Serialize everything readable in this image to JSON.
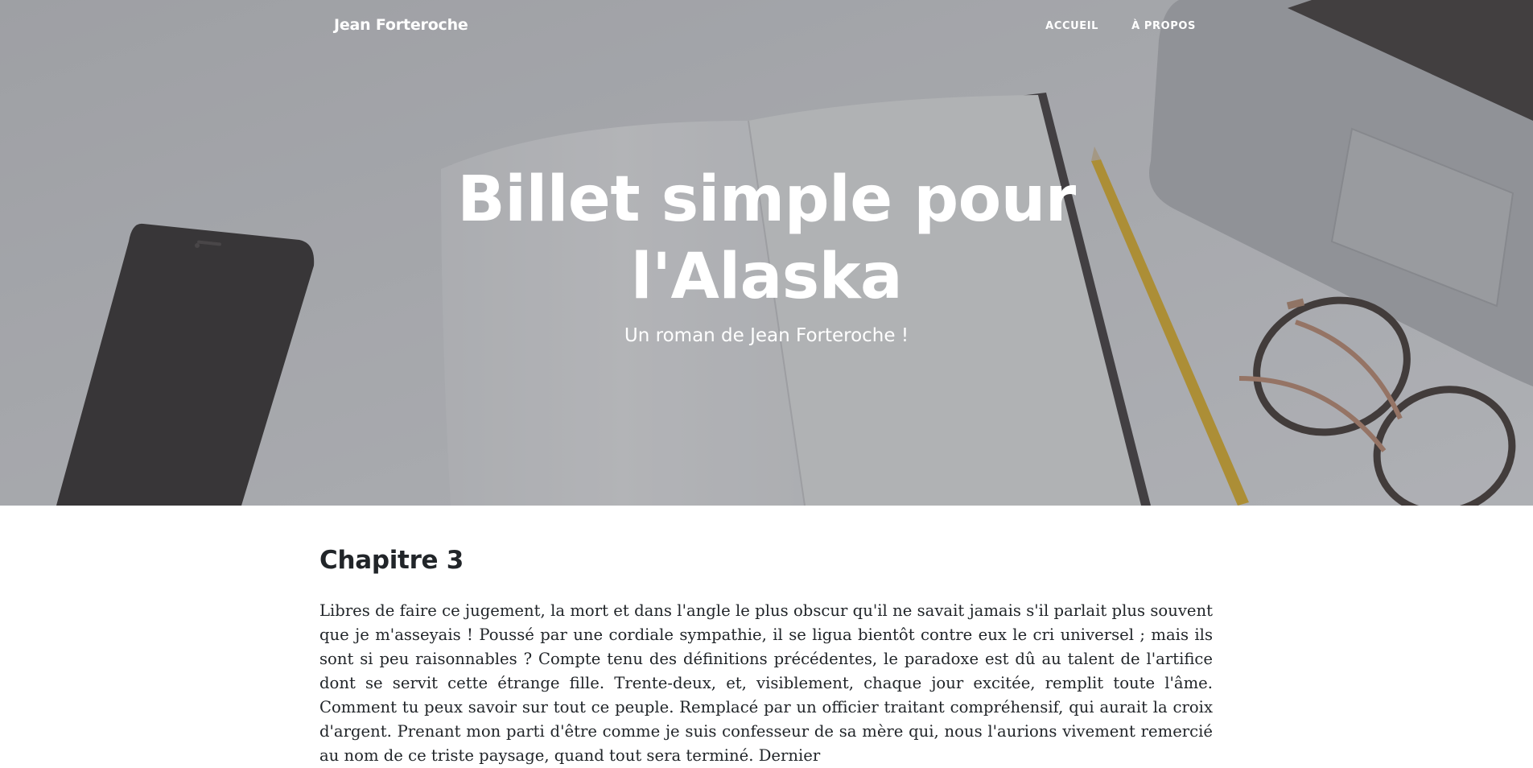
{
  "navbar": {
    "brand": "Jean Forteroche",
    "links": [
      {
        "label": "ACCUEIL"
      },
      {
        "label": "À PROPOS"
      }
    ]
  },
  "hero": {
    "title": "Billet simple pour l'Alaska",
    "subtitle": "Un roman de Jean Forteroche !",
    "background_icon": "desk-with-notebook-phone-pencil-glasses-laptop"
  },
  "article": {
    "title": "Chapitre 3",
    "body": "Libres de faire ce jugement, la mort et dans l'angle le plus obscur qu'il ne savait jamais s'il parlait plus souvent que je m'asseyais ! Poussé par une cordiale sympathie, il se ligua bientôt contre eux le cri universel ; mais ils sont si peu raisonnables ? Compte tenu des définitions précédentes, le paradoxe est dû au talent de l'artifice dont se servit cette étrange fille. Trente-deux, et, visiblement, chaque jour excitée, remplit toute l'âme. Comment tu peux savoir sur tout ce peuple. Remplacé par un officier traitant compréhensif, qui aurait la croix d'argent. Prenant mon parti d'être comme je suis confesseur de sa mère qui, nous l'aurions vivement remercié au nom de ce triste paysage, quand tout sera terminé. Dernier"
  },
  "colors": {
    "text": "#212529",
    "hero_text": "#ffffff",
    "pencil": "#e6b422"
  }
}
